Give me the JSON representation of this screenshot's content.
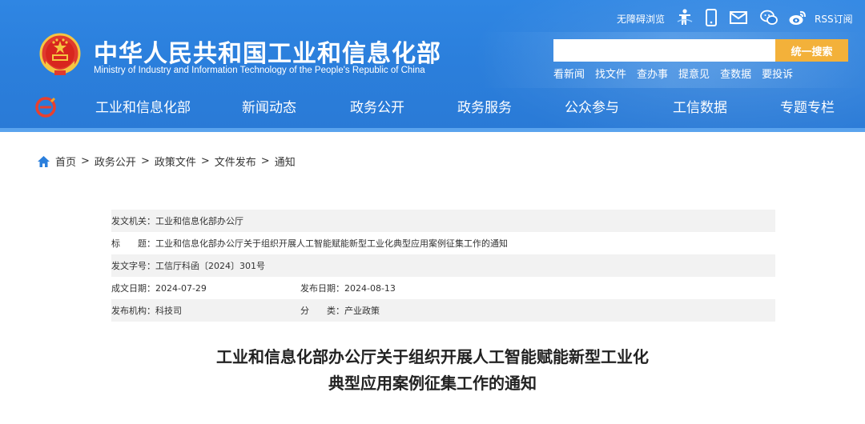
{
  "header": {
    "title": "中华人民共和国工业和信息化部",
    "subtitle": "Ministry of Industry and Information Technology of the People's Republic of China",
    "colors": {
      "header_bg": "#2b7fdc",
      "search_button": "#f3b13a"
    }
  },
  "utility": {
    "accessible_label": "无障碍浏览",
    "rss_label": "RSS订阅",
    "icons": [
      "accessibility-icon",
      "mobile-icon",
      "mail-icon",
      "wechat-icon",
      "weibo-icon"
    ]
  },
  "search": {
    "value": "",
    "placeholder": "",
    "button_label": "统一搜索"
  },
  "quick_links": [
    "看新闻",
    "找文件",
    "查办事",
    "提意见",
    "查数据",
    "要投诉"
  ],
  "nav": {
    "items": [
      "工业和信息化部",
      "新闻动态",
      "政务公开",
      "政务服务",
      "公众参与",
      "工信数据",
      "专题专栏"
    ]
  },
  "breadcrumb": [
    "首页",
    "政务公开",
    "政策文件",
    "文件发布",
    "通知"
  ],
  "info": {
    "issuer_label": "发文机关：",
    "issuer": "工业和信息化部办公厅",
    "title_label": "标　　题：",
    "title": "工业和信息化部办公厅关于组织开展人工智能赋能新型工业化典型应用案例征集工作的通知",
    "doc_no_label": "发文字号：",
    "doc_no": "工信厅科函〔2024〕301号",
    "created_label": "成文日期：",
    "created": "2024-07-29",
    "published_label": "发布日期：",
    "published": "2024-08-13",
    "org_label": "发布机构：",
    "org": "科技司",
    "category_label": "分　　类：",
    "category": "产业政策"
  },
  "article": {
    "title_line1": "工业和信息化部办公厅关于组织开展人工智能赋能新型工业化",
    "title_line2": "典型应用案例征集工作的通知"
  }
}
